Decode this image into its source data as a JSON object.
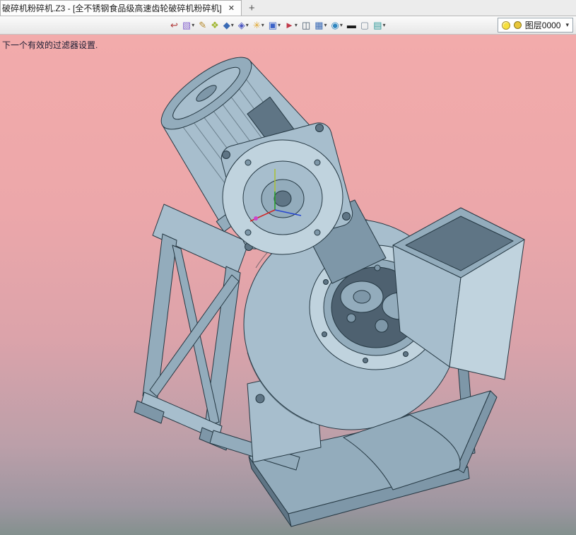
{
  "tab_bar": {
    "document_tab": {
      "title": "破碎机粉碎机.Z3 - [全不锈钢食品级高速齿轮破碎机粉碎机]",
      "close_glyph": "✕"
    },
    "new_tab_glyph": "+"
  },
  "toolbar": {
    "icons": [
      {
        "name": "exit-icon",
        "glyph": "↩",
        "color": "#b03838"
      },
      {
        "name": "face-color-icon",
        "glyph": "▧",
        "color": "#8a6ad0"
      },
      {
        "name": "paint-brush-icon",
        "glyph": "✎",
        "color": "#b58a2e"
      },
      {
        "name": "shade-cube-icon",
        "glyph": "❖",
        "color": "#9fb52e"
      },
      {
        "name": "display-cube-icon",
        "glyph": "◆",
        "color": "#3a6ab5"
      },
      {
        "name": "render-mode-icon",
        "glyph": "◈",
        "color": "#4a55c0"
      },
      {
        "name": "appearance-flower-icon",
        "glyph": "✳",
        "color": "#e0a62e"
      },
      {
        "name": "texture-square-icon",
        "glyph": "▣",
        "color": "#3a62c8"
      },
      {
        "name": "move-arrow-icon",
        "glyph": "►",
        "color": "#c03a4a"
      },
      {
        "name": "section-view-icon",
        "glyph": "◫",
        "color": "#44576a"
      },
      {
        "name": "grid-table-icon",
        "glyph": "▦",
        "color": "#3a6ab5"
      },
      {
        "name": "environment-globe-icon",
        "glyph": "◉",
        "color": "#2e86c0"
      },
      {
        "name": "line-width-icon",
        "glyph": "▬",
        "color": "#1a1a1a"
      },
      {
        "name": "background-color-icon",
        "glyph": "▢",
        "color": "#7a8a9a"
      },
      {
        "name": "layer-stack-icon",
        "glyph": "▤",
        "color": "#2e9a9a"
      }
    ],
    "layer_control": {
      "label": "图层0000",
      "swatch_color": "#e8c63a",
      "menu_glyph": "▾"
    }
  },
  "viewport": {
    "status_message": "下一个有效的过滤器设置.",
    "background_top": "#f2abab",
    "background_bottom": "#82908d",
    "model_body_color": "#a7becd",
    "model_edge_color": "#253843"
  }
}
